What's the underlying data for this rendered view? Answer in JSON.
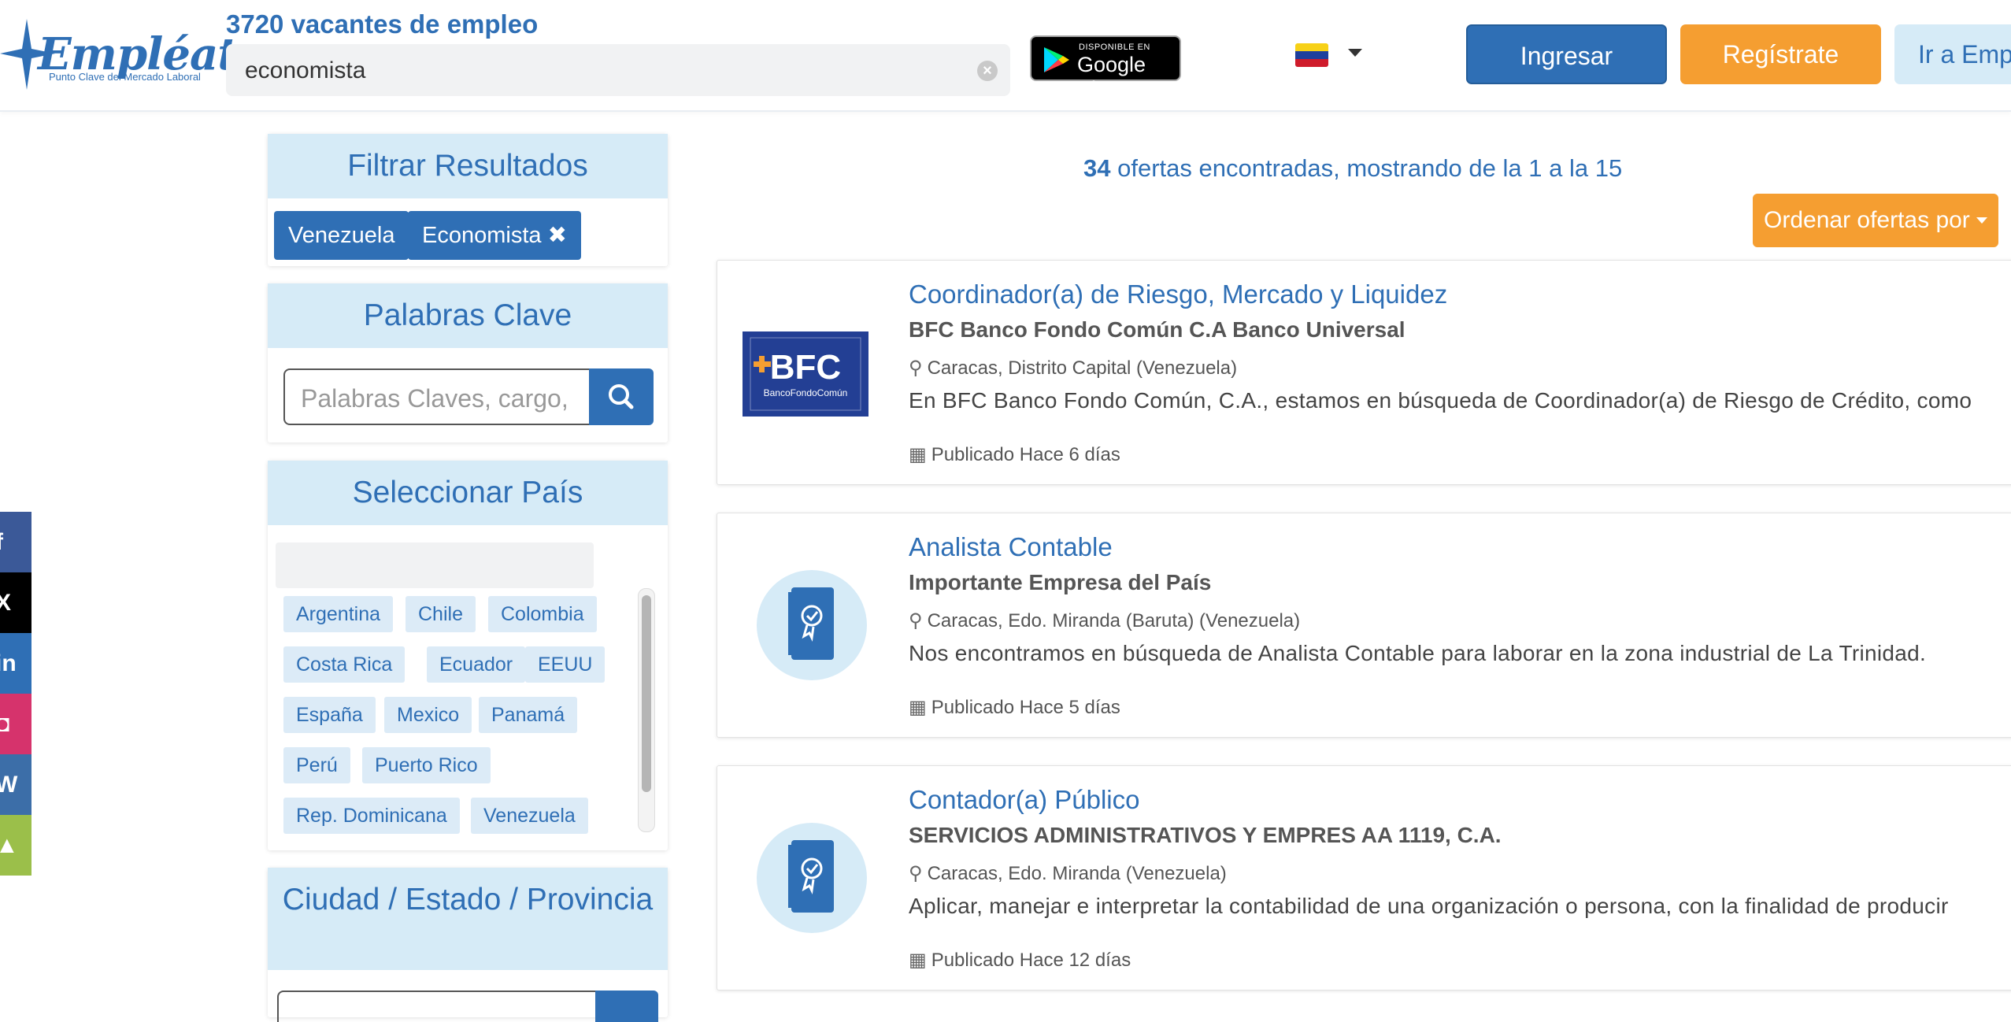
{
  "header": {
    "logo_text": "Empléate",
    "logo_tagline": "Punto Clave del Mercado Laboral",
    "vacancies": "3720 vacantes de empleo",
    "search_value": "economista",
    "gplay_small": "DISPONIBLE EN",
    "gplay_big": "Google Play",
    "country_flag": "Venezuela",
    "login_label": "Ingresar",
    "register_label": "Regístrate",
    "companies_label": "Ir a Emp"
  },
  "social": [
    {
      "name": "facebook",
      "glyph": "f",
      "color": "#3b5998"
    },
    {
      "name": "x",
      "glyph": "X",
      "color": "#000000"
    },
    {
      "name": "linkedin",
      "glyph": "in",
      "color": "#2f6fb5"
    },
    {
      "name": "instagram",
      "glyph": "◘",
      "color": "#d6336c"
    },
    {
      "name": "wordpress",
      "glyph": "W",
      "color": "#3c6ea8"
    },
    {
      "name": "android",
      "glyph": "▲",
      "color": "#9bbf4a"
    }
  ],
  "sidebar": {
    "filter_title": "Filtrar Resultados",
    "filter_tags": [
      "Venezuela",
      "Economista ✖"
    ],
    "keywords_title": "Palabras Clave",
    "keywords_placeholder": "Palabras Claves, cargo,",
    "country_title": "Seleccionar País",
    "countries": [
      "Argentina",
      "Chile",
      "Colombia",
      "Costa Rica",
      "Ecuador",
      "EEUU",
      "España",
      "Mexico",
      "Panamá",
      "Perú",
      "Puerto Rico",
      "Rep. Dominicana",
      "Venezuela"
    ],
    "city_title": "Ciudad / Estado / Provincia"
  },
  "results": {
    "count": "34",
    "summary": "ofertas encontradas, mostrando de la 1 a la 15",
    "sort_label": "Ordenar ofertas por"
  },
  "jobs": [
    {
      "title": "Coordinador(a) de Riesgo, Mercado y Liquidez",
      "company": "BFC Banco Fondo Común C.A Banco Universal",
      "location": "Caracas, Distrito Capital (Venezuela)",
      "description": "En BFC Banco Fondo Común, C.A., estamos en búsqueda de Coordinador(a) de Riesgo de Crédito, como",
      "date": "Publicado Hace 6 días",
      "logo_text": "BFC",
      "logo_sub": "BancoFondoComún"
    },
    {
      "title": "Analista Contable",
      "company": "Importante Empresa del País",
      "location": "Caracas, Edo. Miranda (Baruta) (Venezuela)",
      "description": "Nos encontramos en búsqueda de Analista Contable para laborar en la zona industrial de La Trinidad.",
      "date": "Publicado Hace 5 días"
    },
    {
      "title": "Contador(a) Público",
      "company": "SERVICIOS ADMINISTRATIVOS Y EMPRES AA 1119, C.A.",
      "location": "Caracas, Edo. Miranda (Venezuela)",
      "description": "Aplicar, manejar e interpretar la contabilidad de una organización o persona, con la finalidad de producir",
      "date": "Publicado Hace 12 días"
    }
  ],
  "colors": {
    "brand_blue": "#2f6fb5",
    "accent_orange": "#f59e31",
    "light_blue": "#d6ebf7"
  }
}
